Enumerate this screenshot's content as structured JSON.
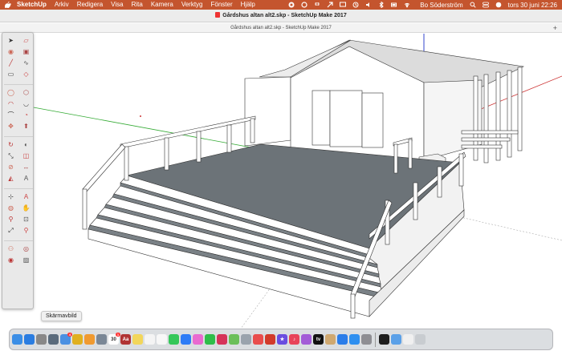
{
  "menubar": {
    "items": [
      "SketchUp",
      "Arkiv",
      "Redigera",
      "Visa",
      "Rita",
      "Kamera",
      "Verktyg",
      "Fönster",
      "Hjälp"
    ],
    "user": "Bo Söderström",
    "datetime": "tors 30 juni  22:26"
  },
  "window": {
    "title": "Gårdshus altan alt2.skp - SketchUp Make 2017",
    "tab": "Gårdshus altan alt2.skp - SketchUp Make 2017"
  },
  "tooltip": {
    "text": "Skärmavbild"
  },
  "colors": {
    "menubar": "#c4552e",
    "deck": "#6c7378",
    "wall": "#ffffff",
    "roof": "#dcdcdc",
    "axis_red": "#cc3333",
    "axis_green": "#33aa33",
    "axis_blue": "#3344cc"
  },
  "toolbar": {
    "tools": [
      "select-icon",
      "eraser-icon",
      "paint-bucket-icon",
      "component-icon",
      "line-icon",
      "freehand-icon",
      "rectangle-icon",
      "rotated-rectangle-icon",
      "circle-icon",
      "polygon-icon",
      "arc-icon",
      "two-point-arc-icon",
      "three-point-arc-icon",
      "pie-icon",
      "move-icon",
      "push-pull-icon",
      "rotate-icon",
      "follow-me-icon",
      "scale-icon",
      "offset-icon",
      "tape-measure-icon",
      "dimension-icon",
      "protractor-icon",
      "text-icon",
      "axes-icon",
      "3d-text-icon",
      "orbit-icon",
      "pan-icon",
      "zoom-icon",
      "zoom-window-icon",
      "zoom-extents-icon",
      "search-icon",
      "walk-icon",
      "position-camera-icon",
      "look-around-icon",
      "section-plane-icon"
    ]
  },
  "dock": {
    "apps": [
      {
        "name": "finder-icon",
        "color": "#3a8ee6",
        "label": ""
      },
      {
        "name": "safari-icon",
        "color": "#2a7de1",
        "label": ""
      },
      {
        "name": "launchpad-icon",
        "color": "#888888",
        "label": ""
      },
      {
        "name": "preview-icon",
        "color": "#5a6b7c",
        "label": ""
      },
      {
        "name": "mail-icon",
        "color": "#4a90e2",
        "label": "",
        "badge": "4"
      },
      {
        "name": "chrome-icon",
        "color": "#e0b020",
        "label": ""
      },
      {
        "name": "photos-icon",
        "color": "#f09a30",
        "label": ""
      },
      {
        "name": "scanner-icon",
        "color": "#7a8796",
        "label": ""
      },
      {
        "name": "calendar-icon",
        "color": "#ffffff",
        "label": "30",
        "badge": "1"
      },
      {
        "name": "dictionary-icon",
        "color": "#b03434",
        "label": "Aa"
      },
      {
        "name": "notes-icon",
        "color": "#f2d65a",
        "label": ""
      },
      {
        "name": "reminders-icon",
        "color": "#f4f4f4",
        "label": ""
      },
      {
        "name": "textedit-icon",
        "color": "#f7f7f7",
        "label": ""
      },
      {
        "name": "messages-icon",
        "color": "#34c759",
        "label": ""
      },
      {
        "name": "messenger-icon",
        "color": "#2e7cf6",
        "label": ""
      },
      {
        "name": "photos-app-icon",
        "color": "#e96ad0",
        "label": ""
      },
      {
        "name": "facetime-icon",
        "color": "#2fbe4a",
        "label": ""
      },
      {
        "name": "music-icon",
        "color": "#d6335a",
        "label": ""
      },
      {
        "name": "maps-icon",
        "color": "#6bbf59",
        "label": ""
      },
      {
        "name": "files-icon",
        "color": "#9aa3ad",
        "label": ""
      },
      {
        "name": "news-icon",
        "color": "#e94d4d",
        "label": ""
      },
      {
        "name": "sketchup-icon",
        "color": "#d23a2a",
        "label": ""
      },
      {
        "name": "imovie-icon",
        "color": "#6a4de0",
        "label": "★"
      },
      {
        "name": "itunes-icon",
        "color": "#e8435a",
        "label": "♪"
      },
      {
        "name": "podcasts-icon",
        "color": "#a35cd7",
        "label": ""
      },
      {
        "name": "appletv-icon",
        "color": "#111111",
        "label": "tv"
      },
      {
        "name": "goat-icon",
        "color": "#cfa870",
        "label": ""
      },
      {
        "name": "bluetooth-icon",
        "color": "#2b7de9",
        "label": ""
      },
      {
        "name": "appstore-icon",
        "color": "#2e8ff0",
        "label": ""
      },
      {
        "name": "settings-icon",
        "color": "#8e8e93",
        "label": ""
      },
      {
        "name": "activity-icon",
        "color": "#1e1e1e",
        "label": ""
      },
      {
        "name": "downloads-icon",
        "color": "#5aa0e8",
        "label": ""
      },
      {
        "name": "document-stack-icon",
        "color": "#f0f0f0",
        "label": ""
      },
      {
        "name": "trash-icon",
        "color": "#c8ccd0",
        "label": ""
      }
    ]
  }
}
